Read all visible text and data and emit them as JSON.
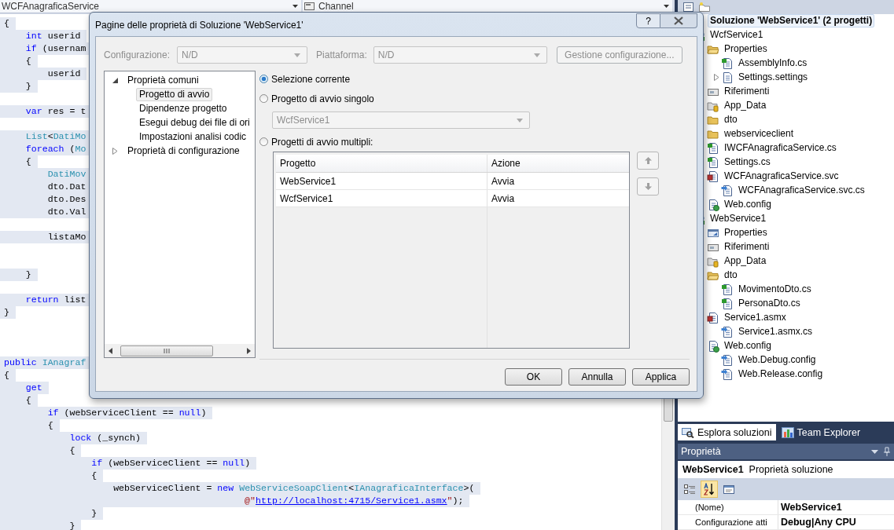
{
  "editor": {
    "type_selector": "WCFAnagraficaService",
    "member_selector": "Channel",
    "text_selected": true,
    "lines": [
      {
        "kind": "code",
        "tokens": [
          {
            "kind": "plain",
            "text": "{"
          }
        ]
      },
      {
        "kind": "code",
        "tokens": [
          {
            "kind": "keyword",
            "text": "    int"
          },
          {
            "kind": "plain",
            "text": " userid"
          }
        ]
      },
      {
        "kind": "code",
        "tokens": [
          {
            "kind": "keyword",
            "text": "    if"
          },
          {
            "kind": "plain",
            "text": " (usernam"
          }
        ]
      },
      {
        "kind": "code",
        "tokens": [
          {
            "kind": "plain",
            "text": "    {"
          }
        ]
      },
      {
        "kind": "code",
        "tokens": [
          {
            "kind": "plain",
            "text": "        userid"
          }
        ]
      },
      {
        "kind": "code",
        "tokens": [
          {
            "kind": "plain",
            "text": "    }"
          }
        ]
      },
      {
        "kind": "blank"
      },
      {
        "kind": "code",
        "tokens": [
          {
            "kind": "keyword",
            "text": "    var"
          },
          {
            "kind": "plain",
            "text": " res = t"
          }
        ]
      },
      {
        "kind": "blank"
      },
      {
        "kind": "code",
        "tokens": [
          {
            "kind": "type",
            "text": "    List"
          },
          {
            "kind": "plain",
            "text": "<"
          },
          {
            "kind": "type",
            "text": "DatiMo"
          }
        ]
      },
      {
        "kind": "code",
        "tokens": [
          {
            "kind": "keyword",
            "text": "    foreach"
          },
          {
            "kind": "plain",
            "text": " ("
          },
          {
            "kind": "type",
            "text": "Mo"
          }
        ]
      },
      {
        "kind": "code",
        "tokens": [
          {
            "kind": "plain",
            "text": "    {"
          }
        ]
      },
      {
        "kind": "code",
        "tokens": [
          {
            "kind": "type",
            "text": "        DatiMov"
          }
        ]
      },
      {
        "kind": "code",
        "tokens": [
          {
            "kind": "plain",
            "text": "        dto.Dat"
          }
        ]
      },
      {
        "kind": "code",
        "tokens": [
          {
            "kind": "plain",
            "text": "        dto.Des"
          }
        ]
      },
      {
        "kind": "code",
        "tokens": [
          {
            "kind": "plain",
            "text": "        dto.Val"
          }
        ]
      },
      {
        "kind": "blank"
      },
      {
        "kind": "code",
        "tokens": [
          {
            "kind": "plain",
            "text": "        listaMo"
          }
        ]
      },
      {
        "kind": "blank"
      },
      {
        "kind": "blank"
      },
      {
        "kind": "code",
        "tokens": [
          {
            "kind": "plain",
            "text": "    }"
          }
        ]
      },
      {
        "kind": "blank"
      },
      {
        "kind": "code",
        "tokens": [
          {
            "kind": "keyword",
            "text": "    return"
          },
          {
            "kind": "plain",
            "text": " list"
          }
        ]
      },
      {
        "kind": "code",
        "tokens": [
          {
            "kind": "plain",
            "text": "}"
          }
        ]
      },
      {
        "kind": "blank"
      },
      {
        "kind": "blank"
      },
      {
        "kind": "blank"
      },
      {
        "kind": "code",
        "tokens": [
          {
            "kind": "keyword",
            "text": "public "
          },
          {
            "kind": "type",
            "text": "IAnagraf"
          }
        ]
      },
      {
        "kind": "code",
        "tokens": [
          {
            "kind": "plain",
            "text": "{"
          }
        ]
      },
      {
        "kind": "code",
        "tokens": [
          {
            "kind": "keyword",
            "text": "    get"
          }
        ]
      },
      {
        "kind": "code",
        "tokens": [
          {
            "kind": "plain",
            "text": "    {"
          }
        ]
      },
      {
        "kind": "code",
        "tokens": [
          {
            "kind": "keyword",
            "text": "        if"
          },
          {
            "kind": "plain",
            "text": " (webServiceClient == "
          },
          {
            "kind": "keyword",
            "text": "null"
          },
          {
            "kind": "plain",
            "text": ")"
          }
        ]
      },
      {
        "kind": "code",
        "tokens": [
          {
            "kind": "plain",
            "text": "        {"
          }
        ]
      },
      {
        "kind": "code",
        "tokens": [
          {
            "kind": "keyword",
            "text": "            lock"
          },
          {
            "kind": "plain",
            "text": " (_synch)"
          }
        ]
      },
      {
        "kind": "code",
        "tokens": [
          {
            "kind": "plain",
            "text": "            {"
          }
        ]
      },
      {
        "kind": "code",
        "tokens": [
          {
            "kind": "keyword",
            "text": "                if"
          },
          {
            "kind": "plain",
            "text": " (webServiceClient == "
          },
          {
            "kind": "keyword",
            "text": "null"
          },
          {
            "kind": "plain",
            "text": ")"
          }
        ]
      },
      {
        "kind": "code",
        "tokens": [
          {
            "kind": "plain",
            "text": "                {"
          }
        ]
      },
      {
        "kind": "code",
        "tokens": [
          {
            "kind": "plain",
            "text": "                    webServiceClient = "
          },
          {
            "kind": "keyword",
            "text": "new "
          },
          {
            "kind": "type",
            "text": "WebServiceSoapClient"
          },
          {
            "kind": "plain",
            "text": "<"
          },
          {
            "kind": "type",
            "text": "IAnagraficaInterface"
          },
          {
            "kind": "plain",
            "text": ">("
          }
        ]
      },
      {
        "kind": "code",
        "tokens": [
          {
            "kind": "string",
            "text": "                                            @\""
          },
          {
            "kind": "url",
            "text": "http://localhost:4715/Service1.asmx"
          },
          {
            "kind": "string",
            "text": "\""
          },
          {
            "kind": "plain",
            "text": ");"
          }
        ]
      },
      {
        "kind": "code",
        "tokens": [
          {
            "kind": "plain",
            "text": "                }"
          }
        ]
      },
      {
        "kind": "code",
        "tokens": [
          {
            "kind": "plain",
            "text": "            }"
          }
        ]
      }
    ]
  },
  "solution_explorer": {
    "tree": {
      "label": "Soluzione 'WebService1'  (2 progetti)",
      "selected": true,
      "children": [
        {
          "label": "WcfService1",
          "kind": "project",
          "selected": false,
          "children": [
            {
              "label": "Properties",
              "kind": "folder-open",
              "selected": false,
              "children": [
                {
                  "label": "AssemblyInfo.cs",
                  "kind": "cs",
                  "selected": false
                },
                {
                  "label": "Settings.settings",
                  "kind": "settings",
                  "selected": false,
                  "expanded": false
                }
              ]
            },
            {
              "label": "Riferimenti",
              "kind": "references",
              "selected": false
            },
            {
              "label": "App_Data",
              "kind": "app-data",
              "selected": false
            },
            {
              "label": "dto",
              "kind": "folder",
              "selected": false
            },
            {
              "label": "webserviceclient",
              "kind": "folder",
              "selected": false
            },
            {
              "label": "IWCFAnagraficaService.cs",
              "kind": "cs",
              "selected": false
            },
            {
              "label": "Settings.cs",
              "kind": "cs",
              "selected": false
            },
            {
              "label": "WCFAnagraficaService.svc",
              "kind": "svc",
              "selected": false,
              "children": [
                {
                  "label": "WCFAnagraficaService.svc.cs",
                  "kind": "code-behind",
                  "selected": false
                }
              ]
            },
            {
              "label": "Web.config",
              "kind": "config",
              "selected": false
            }
          ]
        },
        {
          "label": "WebService1",
          "kind": "project",
          "selected": false,
          "children": [
            {
              "label": "Properties",
              "kind": "properties",
              "selected": false
            },
            {
              "label": "Riferimenti",
              "kind": "references",
              "selected": false
            },
            {
              "label": "App_Data",
              "kind": "app-data",
              "selected": false
            },
            {
              "label": "dto",
              "kind": "folder-open",
              "selected": false,
              "children": [
                {
                  "label": "MovimentoDto.cs",
                  "kind": "cs",
                  "selected": false
                },
                {
                  "label": "PersonaDto.cs",
                  "kind": "cs",
                  "selected": false
                }
              ]
            },
            {
              "label": "Service1.asmx",
              "kind": "svc",
              "selected": false,
              "children": [
                {
                  "label": "Service1.asmx.cs",
                  "kind": "code-behind",
                  "selected": false
                }
              ]
            },
            {
              "label": "Web.config",
              "kind": "config",
              "selected": false,
              "children": [
                {
                  "label": "Web.Debug.config",
                  "kind": "code-behind",
                  "selected": false
                },
                {
                  "label": "Web.Release.config",
                  "kind": "code-behind",
                  "selected": false
                }
              ]
            }
          ]
        }
      ]
    }
  },
  "panel_tabs": [
    {
      "label": "Esplora soluzioni",
      "kind": "explorer",
      "selected": true
    },
    {
      "label": "Team Explorer",
      "kind": "team",
      "selected": false
    }
  ],
  "properties": {
    "title": "Proprietà",
    "object_name": "WebService1",
    "object_type": "Proprietà soluzione",
    "toolbar": [
      {
        "kind": "categorized",
        "selected": false
      },
      {
        "kind": "alphabetical",
        "selected": true
      },
      {
        "kind": "pages",
        "selected": false
      }
    ],
    "rows": [
      {
        "name": "(Nome)",
        "value": "WebService1"
      },
      {
        "name": "Configurazione atti",
        "value": "Debug|Any CPU"
      }
    ]
  },
  "dialog": {
    "title": "Pagine delle proprietà di Soluzione 'WebService1'",
    "help_label": "?",
    "configuration": {
      "label": "Configurazione:",
      "value": "N/D",
      "disabled": true
    },
    "platform": {
      "label": "Piattaforma:",
      "value": "N/D",
      "disabled": true
    },
    "config_manager_button": {
      "label": "Gestione configurazione...",
      "disabled": true
    },
    "nav_tree": [
      {
        "label": "Proprietà comuni",
        "selected": false,
        "expanded": true,
        "children": [
          {
            "label": "Progetto di avvio",
            "selected": true
          },
          {
            "label": "Dipendenze progetto",
            "selected": false
          },
          {
            "label": "Esegui debug dei file di ori",
            "selected": false
          },
          {
            "label": "Impostazioni analisi codic",
            "selected": false
          }
        ]
      },
      {
        "label": "Proprietà di configurazione",
        "selected": false,
        "expanded": false
      }
    ],
    "startup_options": [
      {
        "label": "Selezione corrente",
        "selected": true
      },
      {
        "label": "Progetto di avvio singolo",
        "selected": false
      },
      {
        "label": "Progetti di avvio multipli:",
        "selected": false
      }
    ],
    "single_project": {
      "value": "WcfService1",
      "disabled": true
    },
    "projects_table": {
      "columns": [
        "Progetto",
        "Azione"
      ],
      "rows": [
        [
          "WebService1",
          "Avvia"
        ],
        [
          "WcfService1",
          "Avvia"
        ]
      ]
    },
    "move_buttons": [
      {
        "kind": "up",
        "disabled": true
      },
      {
        "kind": "down",
        "disabled": true
      }
    ],
    "buttons": [
      {
        "label": "OK"
      },
      {
        "label": "Annulla"
      },
      {
        "label": "Applica"
      }
    ]
  }
}
